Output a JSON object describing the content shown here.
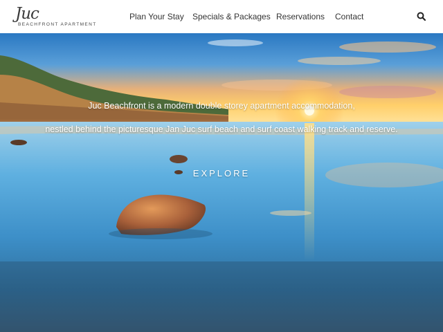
{
  "header": {
    "logo": {
      "script": "Juc",
      "subtitle": "BEACHFRONT APARTMENT"
    },
    "nav": {
      "plan": "Plan Your Stay",
      "specials": "Specials & Packages",
      "reservations": "Reservations",
      "contact": "Contact"
    },
    "search_icon": "search-icon"
  },
  "hero": {
    "line1": "Juc Beachfront is a modern double storey apartment accommodation,",
    "line2": "nestled behind the picturesque Jan Juc surf beach and surf coast walking track and reserve.",
    "cta": "EXPLORE"
  },
  "colors": {
    "header_bg": "#ffffff",
    "nav_text": "#333333",
    "hero_text": "#ffffff",
    "sky_top": "#2f7fc6",
    "sun": "#ffd36a",
    "water": "#4aa3d6"
  }
}
